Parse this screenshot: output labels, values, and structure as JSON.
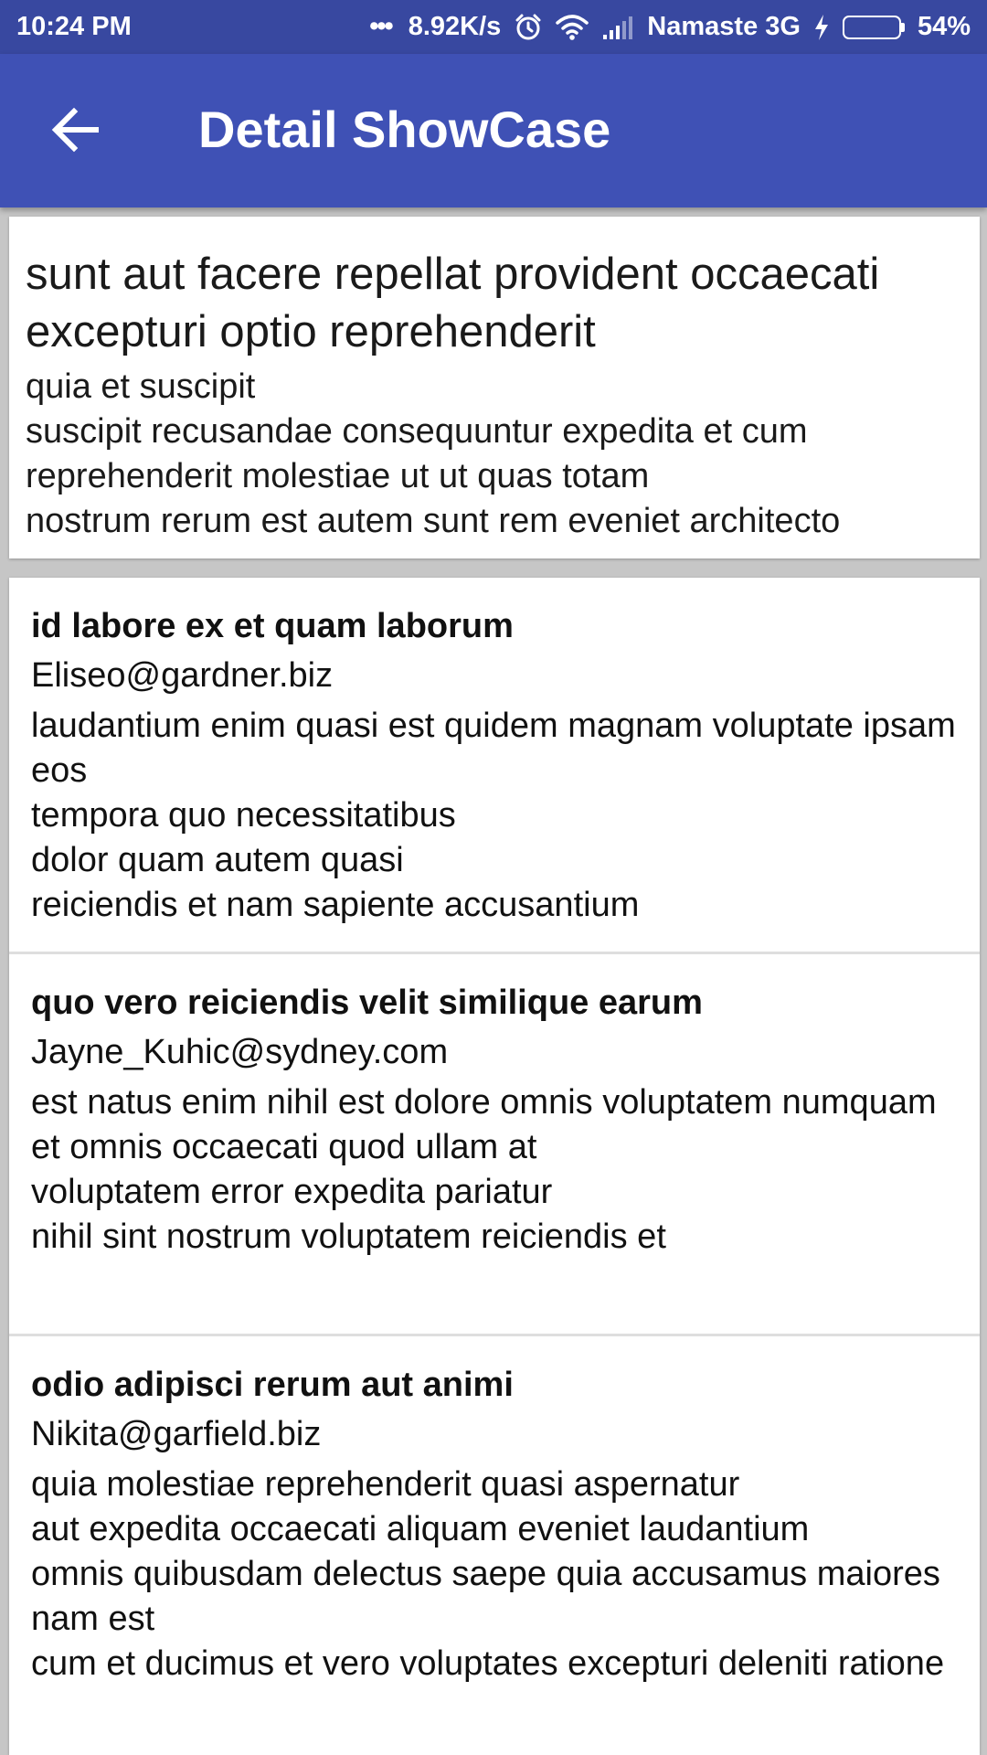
{
  "status_bar": {
    "time": "10:24 PM",
    "network_speed": "8.92K/s",
    "carrier": "Namaste 3G",
    "battery_percent": "54%",
    "battery_level": 0.54,
    "icons": [
      "more-dots-icon",
      "alarm-icon",
      "wifi-icon",
      "signal-icon",
      "charging-icon",
      "battery-icon"
    ]
  },
  "app_bar": {
    "title": "Detail ShowCase",
    "back_icon": "arrow-back-icon"
  },
  "post": {
    "title": "sunt aut facere repellat provident occaecati excepturi optio reprehenderit",
    "body": "quia et suscipit\nsuscipit recusandae consequuntur expedita et cum reprehenderit molestiae ut ut quas totam\nnostrum rerum est autem sunt rem eveniet architecto"
  },
  "comments": [
    {
      "name": "id labore ex et quam laborum",
      "email": "Eliseo@gardner.biz",
      "body": "laudantium enim quasi est quidem magnam voluptate ipsam eos\ntempora quo necessitatibus\ndolor quam autem quasi\nreiciendis et nam sapiente accusantium"
    },
    {
      "name": "quo vero reiciendis velit similique earum",
      "email": "Jayne_Kuhic@sydney.com",
      "body": "est natus enim nihil est dolore omnis voluptatem numquam\net omnis occaecati quod ullam at\nvoluptatem error expedita pariatur\nnihil sint nostrum voluptatem reiciendis et"
    },
    {
      "name": "odio adipisci rerum aut animi",
      "email": "Nikita@garfield.biz",
      "body": "quia molestiae reprehenderit quasi aspernatur\naut expedita occaecati aliquam eveniet laudantium\nomnis quibusdam delectus saepe quia accusamus maiores nam est\ncum et ducimus et vero voluptates excepturi deleniti ratione"
    }
  ],
  "colors": {
    "status_bar": "#3848a0",
    "app_bar": "#3f51b5",
    "background": "#c6c6c6",
    "card": "#ffffff",
    "battery_fill": "#4caf2a"
  }
}
